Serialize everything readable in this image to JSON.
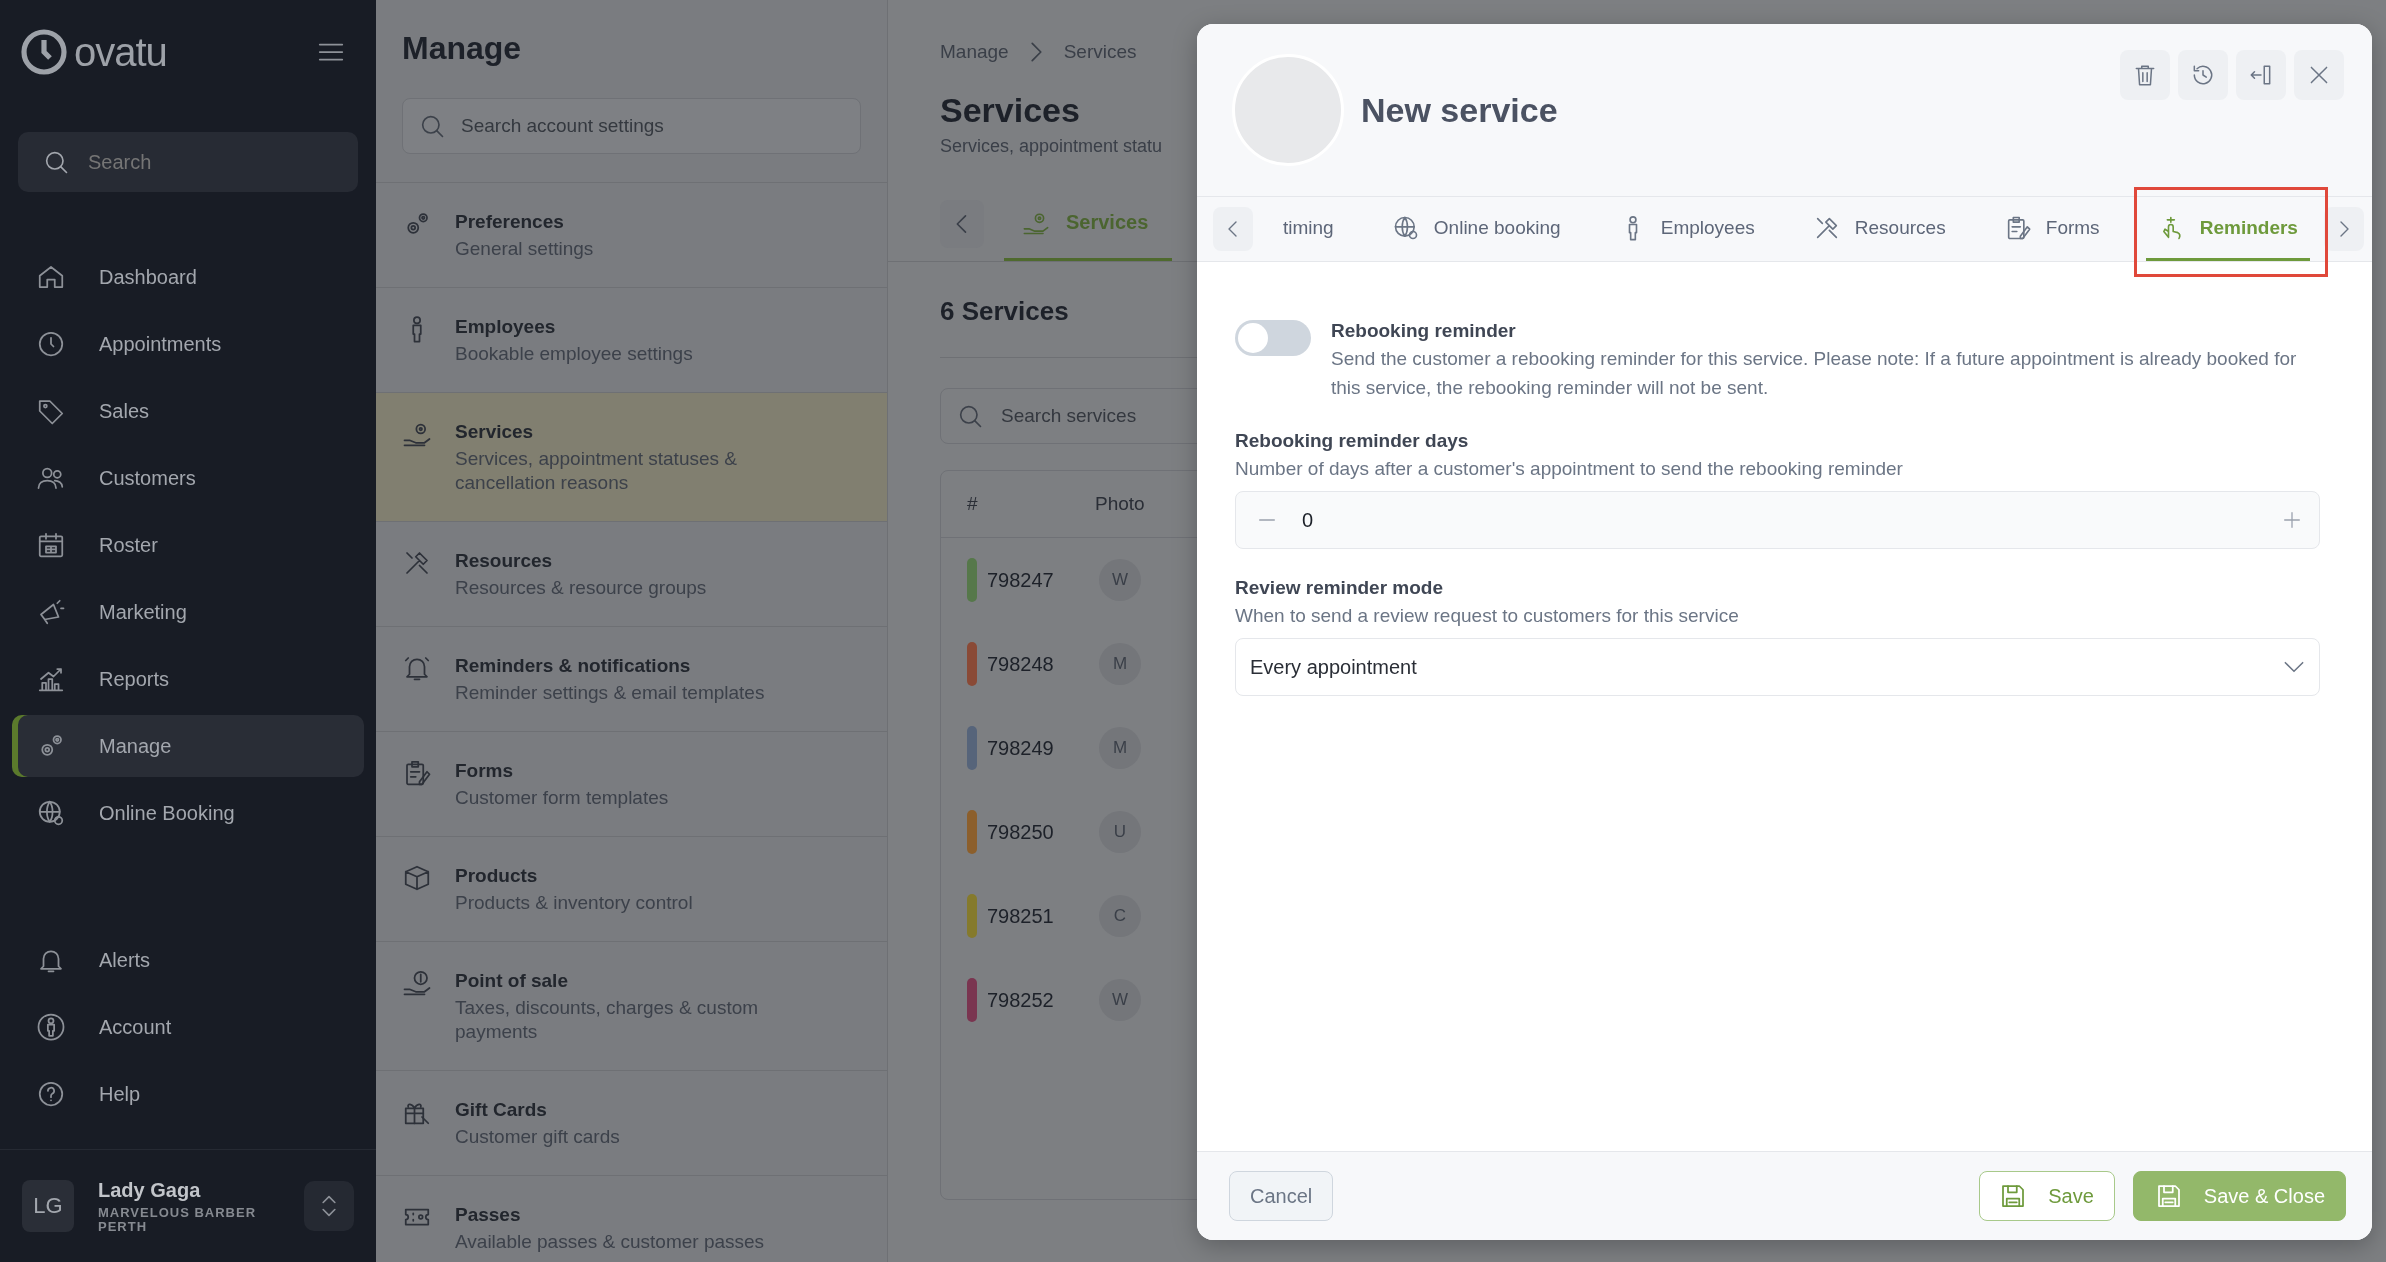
{
  "sidebar": {
    "logo": "ovatu",
    "search": {
      "placeholder": "Search"
    },
    "nav": [
      {
        "label": "Dashboard",
        "selected": false
      },
      {
        "label": "Appointments",
        "selected": false
      },
      {
        "label": "Sales",
        "selected": false
      },
      {
        "label": "Customers",
        "selected": false
      },
      {
        "label": "Roster",
        "selected": false
      },
      {
        "label": "Marketing",
        "selected": false
      },
      {
        "label": "Reports",
        "selected": false
      },
      {
        "label": "Manage",
        "selected": true
      },
      {
        "label": "Online Booking",
        "selected": false
      }
    ],
    "bottom_nav": [
      {
        "label": "Alerts"
      },
      {
        "label": "Account"
      },
      {
        "label": "Help"
      }
    ],
    "user": {
      "initials": "LG",
      "name": "Lady Gaga",
      "business": "MARVELOUS BARBER PERTH"
    }
  },
  "manage_panel": {
    "title": "Manage",
    "search": {
      "placeholder": "Search account settings"
    },
    "items": [
      {
        "title": "Preferences",
        "subtitle": "General settings",
        "selected": false
      },
      {
        "title": "Employees",
        "subtitle": "Bookable employee settings",
        "selected": false
      },
      {
        "title": "Services",
        "subtitle": "Services, appointment statuses & cancellation reasons",
        "selected": true
      },
      {
        "title": "Resources",
        "subtitle": "Resources & resource groups",
        "selected": false
      },
      {
        "title": "Reminders & notifications",
        "subtitle": "Reminder settings & email templates",
        "selected": false
      },
      {
        "title": "Forms",
        "subtitle": "Customer form templates",
        "selected": false
      },
      {
        "title": "Products",
        "subtitle": "Products & inventory control",
        "selected": false
      },
      {
        "title": "Point of sale",
        "subtitle": "Taxes, discounts, charges & custom payments",
        "selected": false
      },
      {
        "title": "Gift Cards",
        "subtitle": "Customer gift cards",
        "selected": false
      },
      {
        "title": "Passes",
        "subtitle": "Available passes & customer passes",
        "selected": false
      }
    ]
  },
  "services_page": {
    "breadcrumb": [
      "Manage",
      "Services"
    ],
    "title": "Services",
    "subtitle": "Services, appointment statu",
    "tab": "Services",
    "count": "6 Services",
    "search": {
      "placeholder": "Search services"
    },
    "table": {
      "columns": [
        "#",
        "Photo"
      ],
      "rows": [
        {
          "id": "798247",
          "color": "#56784a",
          "photo": "W"
        },
        {
          "id": "798248",
          "color": "#8a4a36",
          "photo": "M"
        },
        {
          "id": "798249",
          "color": "#56647a",
          "photo": "M"
        },
        {
          "id": "798250",
          "color": "#8c5f2c",
          "photo": "U"
        },
        {
          "id": "798251",
          "color": "#857a2c",
          "photo": "C"
        },
        {
          "id": "798252",
          "color": "#7a3550",
          "photo": "W"
        }
      ]
    }
  },
  "modal": {
    "title": "New service",
    "tabs": [
      {
        "label": "timing",
        "selected": false,
        "highlighted": false
      },
      {
        "label": "Online booking",
        "selected": false,
        "highlighted": false
      },
      {
        "label": "Employees",
        "selected": false,
        "highlighted": false
      },
      {
        "label": "Resources",
        "selected": false,
        "highlighted": false
      },
      {
        "label": "Forms",
        "selected": false,
        "highlighted": false
      },
      {
        "label": "Reminders",
        "selected": true,
        "highlighted": true
      }
    ],
    "rebooking_reminder": {
      "label": "Rebooking reminder",
      "description": "Send the customer a rebooking reminder for this service. Please note: If a future appointment is already booked for this service, the rebooking reminder will not be sent.",
      "on": false
    },
    "reminder_days": {
      "label": "Rebooking reminder days",
      "description": "Number of days after a customer's appointment to send the rebooking reminder",
      "value": "0"
    },
    "review_mode": {
      "label": "Review reminder mode",
      "description": "When to send a review request to customers for this service",
      "value": "Every appointment"
    },
    "footer_buttons": [
      {
        "label": "Cancel",
        "kind": "cancel"
      },
      {
        "label": "Save",
        "kind": "save"
      },
      {
        "label": "Save & Close",
        "kind": "primary"
      }
    ]
  }
}
